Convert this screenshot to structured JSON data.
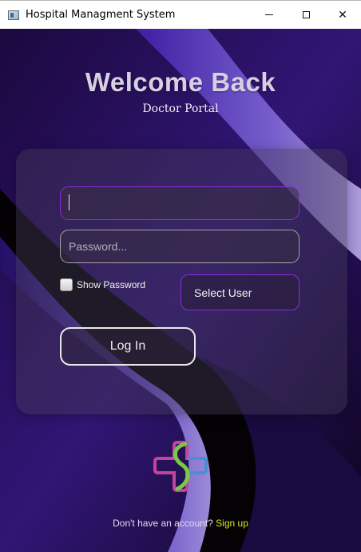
{
  "window": {
    "title": "Hospital Managment System",
    "controls": {
      "minimize": "minimize",
      "maximize": "maximize",
      "close": "✕"
    }
  },
  "header": {
    "title": "Welcome Back",
    "subtitle": "Doctor Portal"
  },
  "form": {
    "username_value": "",
    "password_placeholder": "Password...",
    "password_value": "",
    "show_password_label": "Show Password",
    "show_password_checked": false,
    "select_user_label": "Select User",
    "login_label": "Log In"
  },
  "footer": {
    "prompt": "Don't have an account? ",
    "signup_label": "Sign up"
  },
  "colors": {
    "accent_border": "#8a2be2",
    "signup_link": "#d8e81a",
    "logo_pink": "#c2459a",
    "logo_green": "#7ac943",
    "logo_blue": "#4a8fd4"
  },
  "icons": {
    "app": "app-window-icon",
    "logo": "medical-cross-logo"
  }
}
